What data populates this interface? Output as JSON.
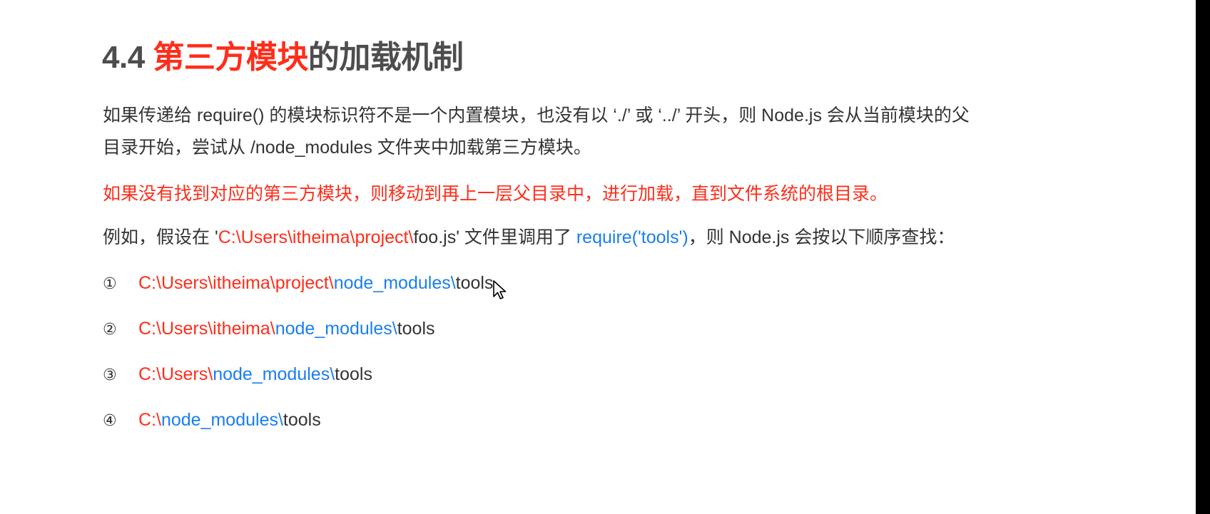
{
  "title": {
    "number": "4.4 ",
    "accent": "第三方模块",
    "rest": "的加载机制"
  },
  "paragraph1": {
    "line1": "如果传递给 require() 的模块标识符不是一个内置模块，也没有以 ‘./’ 或 ‘../’ 开头，则 Node.js 会从当前模块的父",
    "line2": "目录开始，尝试从 /node_modules 文件夹中加载第三方模块。"
  },
  "paragraph2": "如果没有找到对应的第三方模块，则移动到再上一层父目录中，进行加载，直到文件系统的根目录。",
  "paragraph3": {
    "prefix": "例如，假设在 '",
    "red_path": "C:\\Users\\itheima\\project\\",
    "file": "foo.js' 文件里调用了 ",
    "call": "require('tools')",
    "suffix": "，则 Node.js 会按以下顺序查找："
  },
  "search_paths": [
    {
      "num": "①",
      "red": "C:\\Users\\itheima\\project\\",
      "blue": "node_modules\\",
      "tail": "tools"
    },
    {
      "num": "②",
      "red": "C:\\Users\\itheima\\",
      "blue": "node_modules\\",
      "tail": "tools"
    },
    {
      "num": "③",
      "red": "C:\\Users\\",
      "blue": "node_modules\\",
      "tail": "tools"
    },
    {
      "num": "④",
      "red": "C:\\",
      "blue": "node_modules\\",
      "tail": "tools"
    }
  ],
  "colors": {
    "accent_red": "#ff2d1a",
    "link_blue": "#1a7ef0",
    "text": "#333333",
    "title_gray": "#4d4d4d"
  },
  "icons": {
    "cursor": "mouse-pointer-icon"
  }
}
